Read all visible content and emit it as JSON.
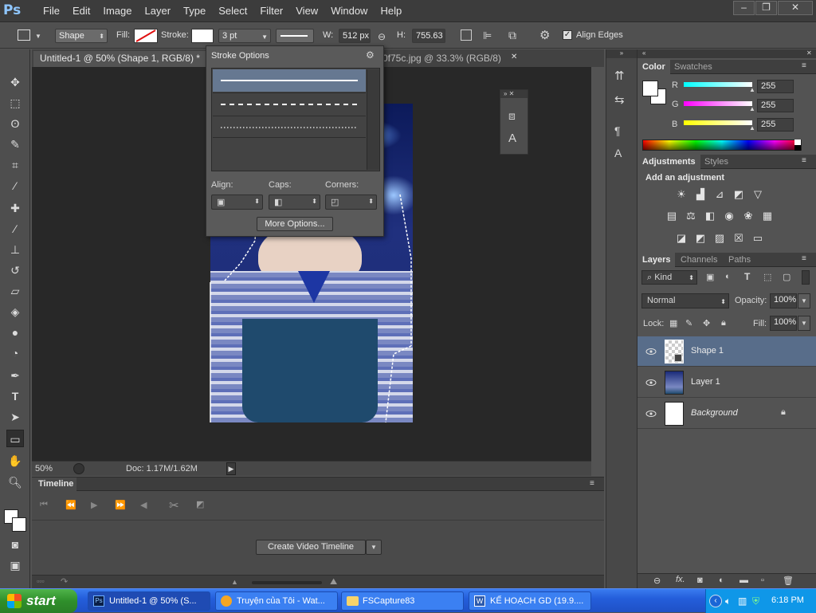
{
  "app": {
    "logo": "Ps"
  },
  "menu": [
    "File",
    "Edit",
    "Image",
    "Layer",
    "Type",
    "Select",
    "Filter",
    "View",
    "Window",
    "Help"
  ],
  "window_controls": {
    "minimize": "–",
    "restore": "❐",
    "close": "✕"
  },
  "options": {
    "tool_mode": "Shape",
    "fill_label": "Fill:",
    "stroke_label": "Stroke:",
    "stroke_width": "3 pt",
    "w_label": "W:",
    "w_value": "512 px",
    "h_label": "H:",
    "h_value": "755.63",
    "align_edges": "Align Edges"
  },
  "tabs": [
    {
      "label": "Untitled-1 @ 50% (Shape 1, RGB/8) *",
      "active": true
    },
    {
      "label": "0f75c.jpg @ 33.3% (RGB/8)",
      "active": false
    }
  ],
  "stroke_options": {
    "title": "Stroke Options",
    "align_label": "Align:",
    "caps_label": "Caps:",
    "corners_label": "Corners:",
    "more_button": "More Options..."
  },
  "status": {
    "zoom": "50%",
    "doc": "Doc: 1.17M/1.62M"
  },
  "timeline": {
    "title": "Timeline",
    "create_button": "Create Video Timeline"
  },
  "color_panel": {
    "tabs": [
      "Color",
      "Swatches"
    ],
    "channels": [
      {
        "label": "R",
        "value": "255",
        "color": "#00ffff"
      },
      {
        "label": "G",
        "value": "255",
        "color": "#ff00ff"
      },
      {
        "label": "B",
        "value": "255",
        "color": "#ffff00"
      }
    ]
  },
  "adjustments_panel": {
    "tabs": [
      "Adjustments",
      "Styles"
    ],
    "heading": "Add an adjustment"
  },
  "layers_panel": {
    "tabs": [
      "Layers",
      "Channels",
      "Paths"
    ],
    "filter_kind": "Kind",
    "blend_mode": "Normal",
    "opacity_label": "Opacity:",
    "opacity_value": "100%",
    "lock_label": "Lock:",
    "fill_label": "Fill:",
    "fill_value": "100%",
    "layers": [
      {
        "name": "Shape 1",
        "selected": true
      },
      {
        "name": "Layer 1",
        "selected": false
      },
      {
        "name": "Background",
        "selected": false,
        "locked": true
      }
    ]
  },
  "taskbar": {
    "start": "start",
    "tasks": [
      {
        "label": "Untitled-1 @ 50% (S...",
        "active": true
      },
      {
        "label": "Truyện của Tôi - Wat...",
        "active": false
      },
      {
        "label": "FSCapture83",
        "active": false
      },
      {
        "label": "KẾ HOẠCH GD (19.9....",
        "active": false
      }
    ],
    "clock": "6:18 PM"
  }
}
